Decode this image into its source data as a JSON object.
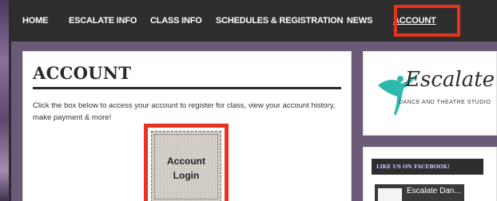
{
  "nav": {
    "items": [
      {
        "label": "HOME"
      },
      {
        "label": "ESCALATE INFO"
      },
      {
        "label": "CLASS INFO"
      },
      {
        "label": "SCHEDULES & REGISTRATION"
      },
      {
        "label": "NEWS"
      },
      {
        "label": "ACCOUNT",
        "active": true
      }
    ]
  },
  "main": {
    "title": "ACCOUNT",
    "description": "Click the box below to access your account to register for class, view your account history, make payment  & more!",
    "login_line1": "Account",
    "login_line2": "Login"
  },
  "sidebar": {
    "logo_text": "Escalate",
    "logo_subtext": "DANCE AND THEATRE STUDIO",
    "facebook_title": "LIKE US ON FACEBOOK!",
    "facebook_page_name": "Escalate Dan..."
  },
  "colors": {
    "nav_bg": "#2e2e2e",
    "highlight": "#e8321e",
    "logo_accent": "#2fb8b0",
    "facebook_title": "#d8c7ff"
  }
}
